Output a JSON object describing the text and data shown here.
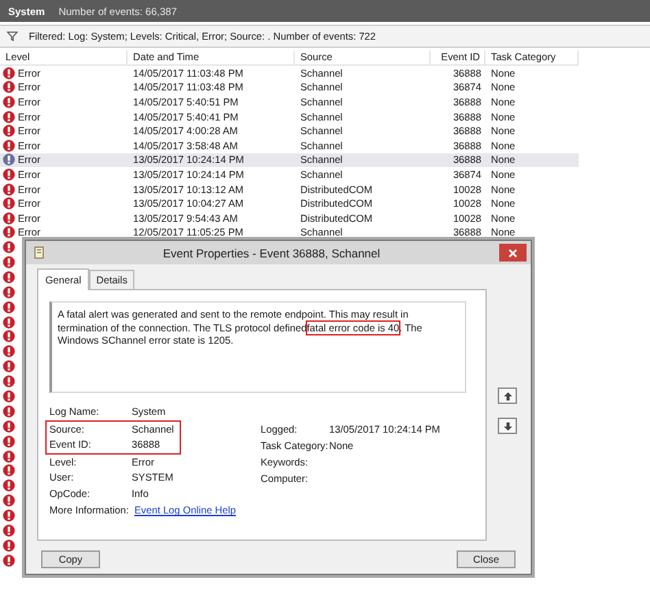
{
  "top_bar": {
    "log": "System",
    "count": "Number of events: 66,387"
  },
  "filter": {
    "text": "Filtered: Log: System; Levels: Critical, Error; Source: . Number of events: 722"
  },
  "table": {
    "columns": [
      "Level",
      "Date and Time",
      "Source",
      "Event ID",
      "Task Category"
    ],
    "rows": [
      {
        "level": "Error",
        "date": "14/05/2017 11:03:48 PM",
        "source": "Schannel",
        "event_id": "36888",
        "category": "None",
        "selected": false
      },
      {
        "level": "Error",
        "date": "14/05/2017 11:03:48 PM",
        "source": "Schannel",
        "event_id": "36874",
        "category": "None",
        "selected": false
      },
      {
        "level": "Error",
        "date": "14/05/2017 5:40:51 PM",
        "source": "Schannel",
        "event_id": "36888",
        "category": "None",
        "selected": false
      },
      {
        "level": "Error",
        "date": "14/05/2017 5:40:41 PM",
        "source": "Schannel",
        "event_id": "36888",
        "category": "None",
        "selected": false
      },
      {
        "level": "Error",
        "date": "14/05/2017 4:00:28 AM",
        "source": "Schannel",
        "event_id": "36888",
        "category": "None",
        "selected": false
      },
      {
        "level": "Error",
        "date": "14/05/2017 3:58:48 AM",
        "source": "Schannel",
        "event_id": "36888",
        "category": "None",
        "selected": false
      },
      {
        "level": "Error",
        "date": "13/05/2017 10:24:14 PM",
        "source": "Schannel",
        "event_id": "36888",
        "category": "None",
        "selected": true
      },
      {
        "level": "Error",
        "date": "13/05/2017 10:24:14 PM",
        "source": "Schannel",
        "event_id": "36874",
        "category": "None",
        "selected": false
      },
      {
        "level": "Error",
        "date": "13/05/2017 10:13:12 AM",
        "source": "DistributedCOM",
        "event_id": "10028",
        "category": "None",
        "selected": false
      },
      {
        "level": "Error",
        "date": "13/05/2017 10:04:27 AM",
        "source": "DistributedCOM",
        "event_id": "10028",
        "category": "None",
        "selected": false
      },
      {
        "level": "Error",
        "date": "13/05/2017 9:54:43 AM",
        "source": "DistributedCOM",
        "event_id": "10028",
        "category": "None",
        "selected": false
      },
      {
        "level": "Error",
        "date": "12/05/2017 11:05:25 PM",
        "source": "Schannel",
        "event_id": "36888",
        "category": "None",
        "selected": false
      }
    ],
    "covered_rows": [
      {
        "kind": "error"
      },
      {
        "kind": "error"
      },
      {
        "kind": "error"
      },
      {
        "kind": "error"
      },
      {
        "kind": "error"
      },
      {
        "kind": "error"
      },
      {
        "kind": "error"
      },
      {
        "kind": "error"
      },
      {
        "kind": "error"
      },
      {
        "kind": "error"
      },
      {
        "kind": "error"
      },
      {
        "kind": "error"
      },
      {
        "kind": "error"
      },
      {
        "kind": "error"
      },
      {
        "kind": "error"
      },
      {
        "kind": "error"
      },
      {
        "kind": "error"
      },
      {
        "kind": "error"
      },
      {
        "kind": "error"
      },
      {
        "kind": "error"
      },
      {
        "kind": "error"
      },
      {
        "kind": "error"
      }
    ]
  },
  "dialog": {
    "title": "Event Properties - Event 36888, Schannel",
    "tabs": [
      {
        "label": "General",
        "selected": true
      },
      {
        "label": "Details",
        "selected": false
      }
    ],
    "description": [
      {
        "text": "A fatal alert was generated and sent to the remote endpoint. This may result in termination of the connection. The TLS protocol defined",
        "highlighted": false
      },
      {
        "text": "fatal error code is 40",
        "highlighted": true
      },
      {
        "text": ". The Windows SChannel error state is 1205.",
        "highlighted": false
      }
    ],
    "left_fields": [
      {
        "label": "Log Name:",
        "value": "System",
        "highlighted": false
      },
      {
        "label": "Source:",
        "value": "Schannel",
        "highlighted": true
      },
      {
        "label": "Event ID:",
        "value": "36888",
        "highlighted": true
      },
      {
        "label": "Level:",
        "value": "Error",
        "highlighted": false
      },
      {
        "label": "User:",
        "value": "SYSTEM",
        "highlighted": false
      },
      {
        "label": "OpCode:",
        "value": "Info",
        "highlighted": false
      }
    ],
    "right_fields": [
      {
        "label": "Logged:",
        "value": "13/05/2017 10:24:14 PM"
      },
      {
        "label": "Task Category:",
        "value": "None"
      },
      {
        "label": "Keywords:"
      },
      {
        "label": "Computer:"
      }
    ],
    "more_info": {
      "label": "More Information:",
      "link": "Event Log Online Help"
    },
    "buttons": [
      "Copy",
      "Close"
    ]
  }
}
